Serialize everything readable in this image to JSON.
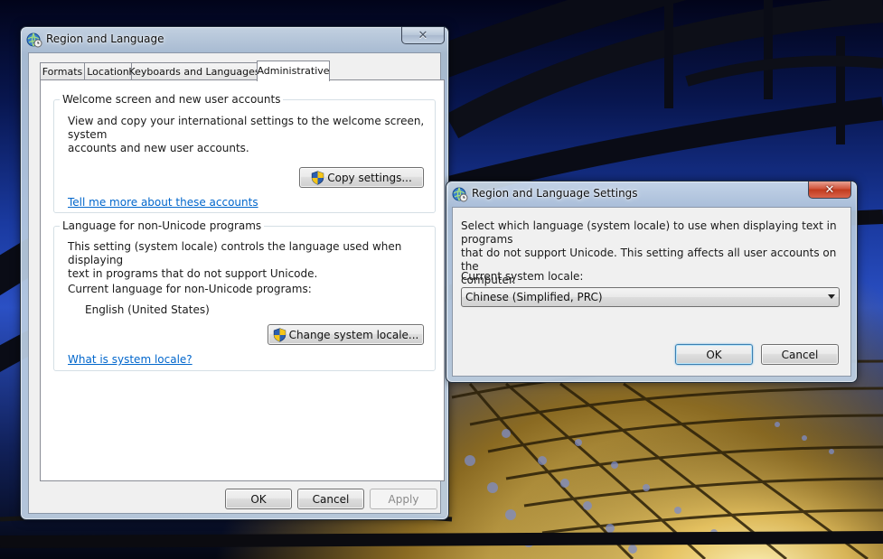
{
  "desktop": {
    "wallpaper": "bridge-arch-photo"
  },
  "main_window": {
    "title": "Region and Language",
    "close_glyph": "✕",
    "tabs": [
      {
        "label": "Formats"
      },
      {
        "label": "Location"
      },
      {
        "label": "Keyboards and Languages"
      },
      {
        "label": "Administrative",
        "selected": true
      }
    ],
    "welcome_group": {
      "title": "Welcome screen and new user accounts",
      "line1": "View and copy your international settings to the welcome screen, system",
      "line2": "accounts and new user accounts.",
      "copy_button": "Copy settings...",
      "link": "Tell me more about these accounts"
    },
    "nonunicode_group": {
      "title": "Language for non-Unicode programs",
      "line1": "This setting (system locale) controls the language used when displaying",
      "line2": "text in programs that do not support Unicode.",
      "current_label": "Current language for non-Unicode programs:",
      "current_value": "English (United States)",
      "change_button": "Change system locale...",
      "link": "What is system locale?"
    },
    "buttons": {
      "ok": "OK",
      "cancel": "Cancel",
      "apply": "Apply"
    }
  },
  "locale_dialog": {
    "title": "Region and Language Settings",
    "close_glyph": "✕",
    "line1": "Select which language (system locale) to use when displaying text in programs",
    "line2": "that do not support Unicode. This setting affects all user accounts on the",
    "line3": "computer.",
    "locale_label": "Current system locale:",
    "locale_value": "Chinese (Simplified, PRC)",
    "ok": "OK",
    "cancel": "Cancel"
  },
  "colors": {
    "link": "#0066cc",
    "close_active": "#c13b1d"
  }
}
